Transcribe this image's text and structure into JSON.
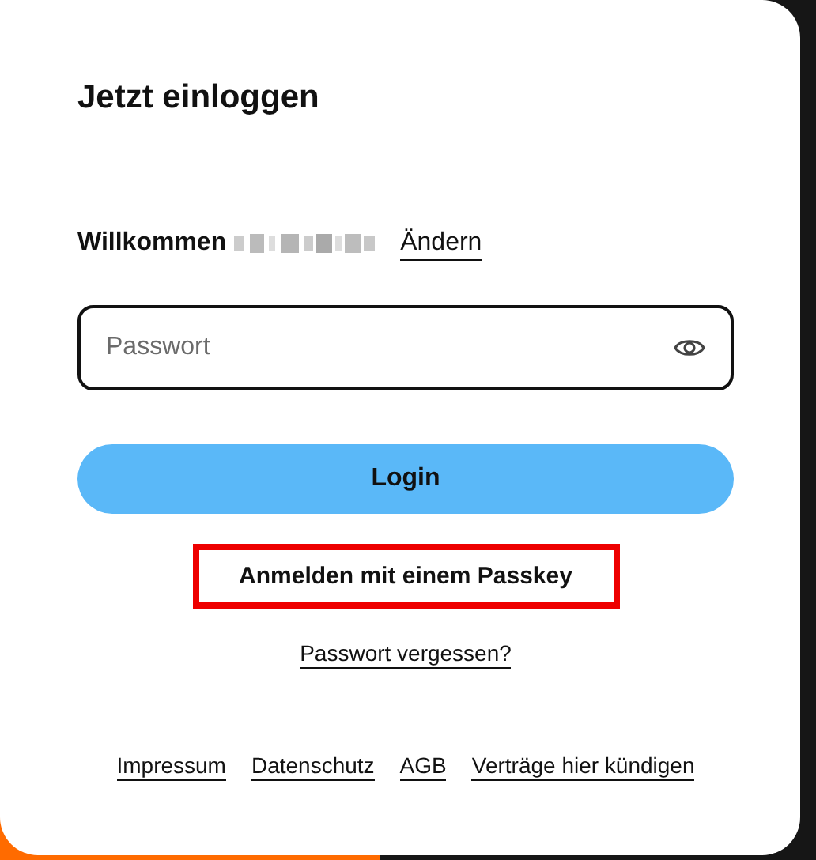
{
  "title": "Jetzt einloggen",
  "welcome": {
    "text": "Willkommen",
    "change_link": "Ändern"
  },
  "password_field": {
    "placeholder": "Passwort"
  },
  "login_button": "Login",
  "passkey_button": {
    "label": "Anmelden mit einem Passkey",
    "highlighted": true
  },
  "forgot_link": "Passwort vergessen?",
  "footer_links": [
    "Impressum",
    "Datenschutz",
    "AGB",
    "Verträge hier kündigen"
  ]
}
